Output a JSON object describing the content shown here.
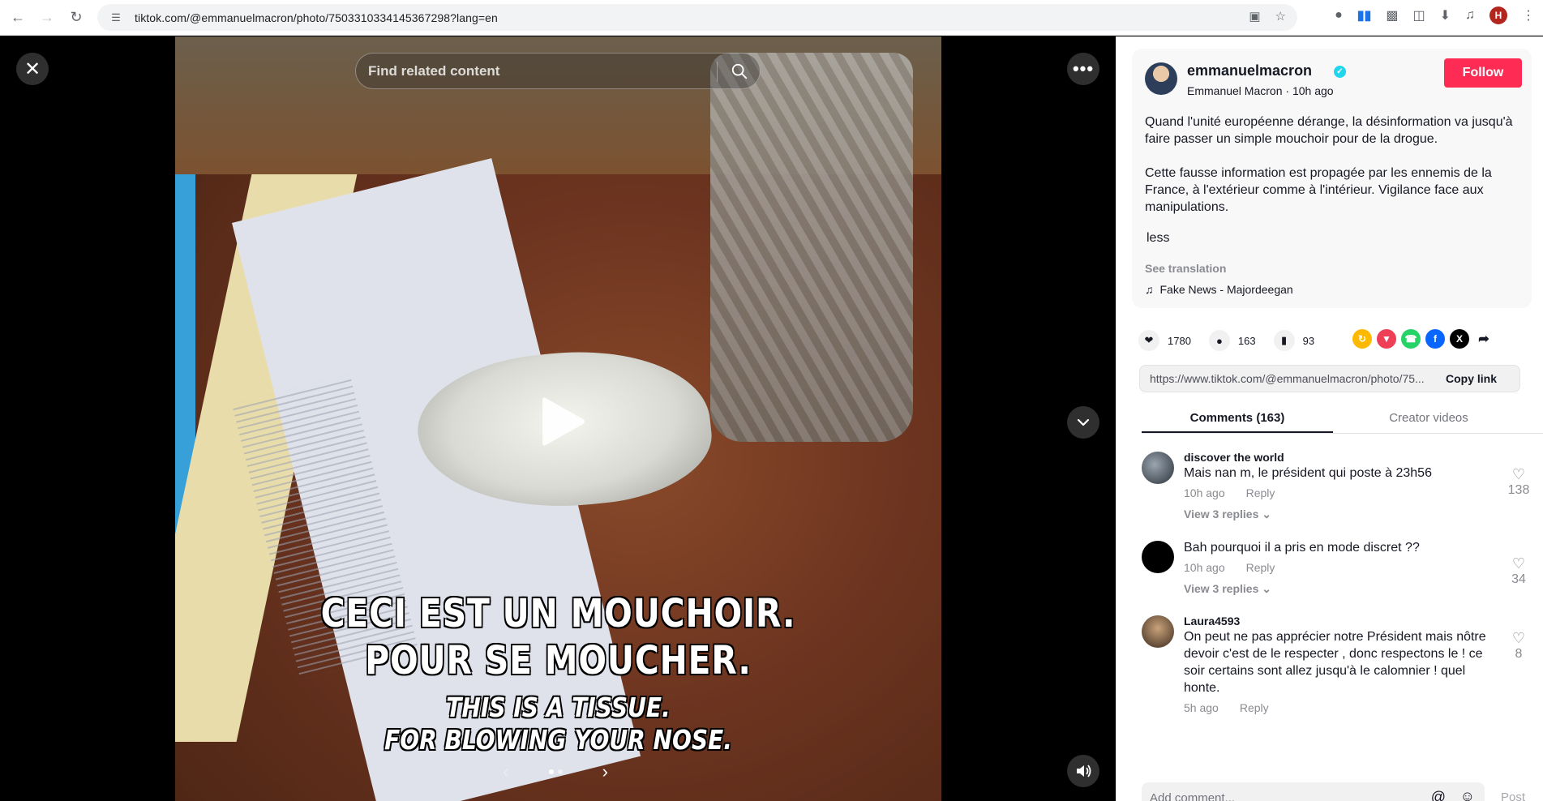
{
  "browser": {
    "url": "tiktok.com/@emmanuelmacron/photo/7503310334145367298?lang=en",
    "avatar_letter": "H"
  },
  "media": {
    "search_placeholder": "Find related content",
    "caption_fr_line1": "CECI EST UN MOUCHOIR.",
    "caption_fr_line2": "POUR SE MOUCHER.",
    "caption_en_line1": "THIS IS A TISSUE.",
    "caption_en_line2": "FOR BLOWING YOUR NOSE.",
    "slides_total": 2,
    "slide_active": 1
  },
  "post": {
    "username": "emmanuelmacron",
    "display_name": "Emmanuel Macron",
    "time": "10h ago",
    "follow_label": "Follow",
    "description_p1": "Quand l'unité européenne dérange, la désinformation va jusqu'à faire passer un simple mouchoir pour de la drogue.",
    "description_p2": "Cette fausse information est propagée par les ennemis de la France, à l'extérieur comme à l'intérieur. Vigilance face aux manipulations.",
    "less_label": "less",
    "see_translation": "See translation",
    "music": "Fake News - Majordeegan"
  },
  "stats": {
    "likes": "1780",
    "comments": "163",
    "saves": "93"
  },
  "share": {
    "link": "https://www.tiktok.com/@emmanuelmacron/photo/75...",
    "copy_label": "Copy link",
    "icons": [
      "repost-icon",
      "pocket-icon",
      "whatsapp-icon",
      "facebook-icon",
      "x-icon",
      "share-arrow-icon"
    ]
  },
  "tabs": {
    "comments": "Comments (163)",
    "creator_videos": "Creator videos"
  },
  "comments": [
    {
      "user": "discover the world",
      "text": "Mais nan m, le président qui poste à 23h56",
      "time": "10h ago",
      "reply": "Reply",
      "replies": "View 3 replies",
      "likes": "138"
    },
    {
      "user": "",
      "text": "Bah pourquoi il a pris en mode discret ??",
      "time": "10h ago",
      "reply": "Reply",
      "replies": "View 3 replies",
      "likes": "34"
    },
    {
      "user": "Laura4593",
      "text": "On peut ne pas apprécier notre Président mais nôtre devoir c'est de le respecter , donc respectons le ! ce soir certains sont allez jusqu'à le calomnier ! quel honte.",
      "time": "5h ago",
      "reply": "Reply",
      "replies": "",
      "likes": "8"
    }
  ],
  "composer": {
    "placeholder": "Add comment...",
    "post_label": "Post"
  },
  "colors": {
    "brand_red": "#fe2c55",
    "verified": "#20d5ec"
  }
}
